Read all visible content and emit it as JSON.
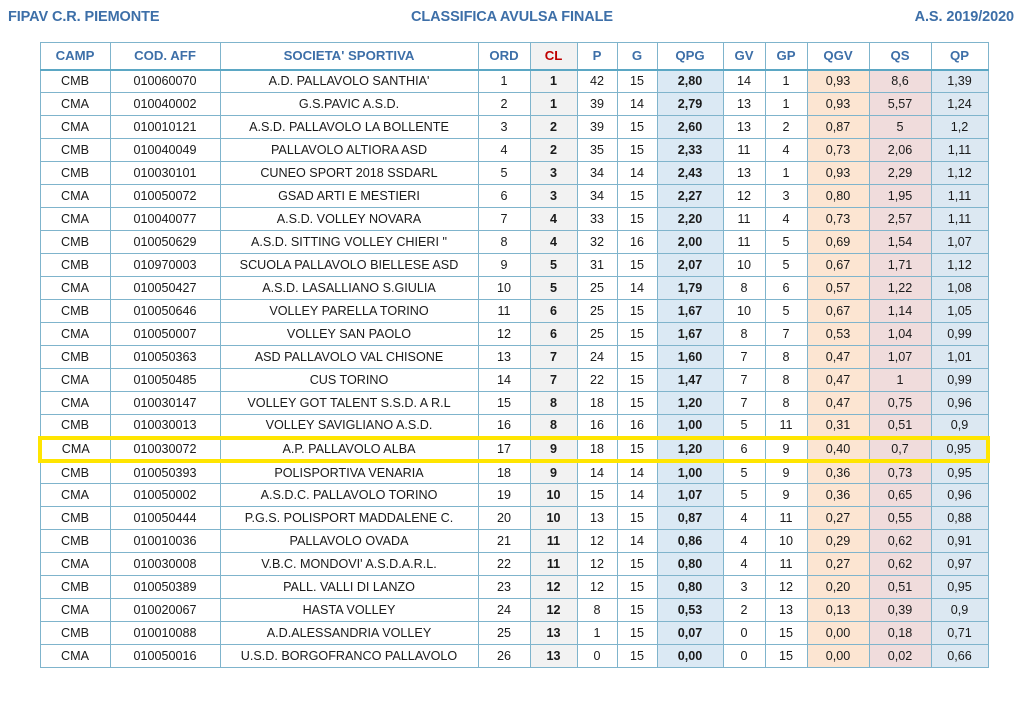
{
  "header": {
    "left": "FIPAV C.R. PIEMONTE",
    "center": "CLASSIFICA AVULSA FINALE",
    "right": "A.S. 2019/2020"
  },
  "colors": {
    "header_text": "#3d6fa8",
    "border": "#7fb4cc",
    "cl_text": "#c00000",
    "qpg_bg": "#dbe9f4",
    "qgv_bg": "#fce5d2",
    "qs_bg": "#f0dcdc",
    "qp_bg": "#dce8f2",
    "cl_bg": "#f2f2f2",
    "highlight": "#ffe500"
  },
  "table": {
    "columns": [
      {
        "key": "camp",
        "label": "CAMP"
      },
      {
        "key": "cod",
        "label": "COD. AFF"
      },
      {
        "key": "soc",
        "label": "SOCIETA' SPORTIVA"
      },
      {
        "key": "ord",
        "label": "ORD"
      },
      {
        "key": "cl",
        "label": "CL"
      },
      {
        "key": "p",
        "label": "P"
      },
      {
        "key": "g",
        "label": "G"
      },
      {
        "key": "qpg",
        "label": "QPG"
      },
      {
        "key": "gv",
        "label": "GV"
      },
      {
        "key": "gp",
        "label": "GP"
      },
      {
        "key": "qgv",
        "label": "QGV"
      },
      {
        "key": "qs",
        "label": "QS"
      },
      {
        "key": "qp",
        "label": "QP"
      }
    ],
    "highlighted_row_index": 16,
    "rows": [
      [
        "CMB",
        "010060070",
        "A.D. PALLAVOLO SANTHIA'",
        "1",
        "1",
        "42",
        "15",
        "2,80",
        "14",
        "1",
        "0,93",
        "8,6",
        "1,39"
      ],
      [
        "CMA",
        "010040002",
        "G.S.PAVIC A.S.D.",
        "2",
        "1",
        "39",
        "14",
        "2,79",
        "13",
        "1",
        "0,93",
        "5,57",
        "1,24"
      ],
      [
        "CMA",
        "010010121",
        "A.S.D. PALLAVOLO LA BOLLENTE",
        "3",
        "2",
        "39",
        "15",
        "2,60",
        "13",
        "2",
        "0,87",
        "5",
        "1,2"
      ],
      [
        "CMB",
        "010040049",
        "PALLAVOLO ALTIORA ASD",
        "4",
        "2",
        "35",
        "15",
        "2,33",
        "11",
        "4",
        "0,73",
        "2,06",
        "1,11"
      ],
      [
        "CMB",
        "010030101",
        "CUNEO SPORT 2018 SSDARL",
        "5",
        "3",
        "34",
        "14",
        "2,43",
        "13",
        "1",
        "0,93",
        "2,29",
        "1,12"
      ],
      [
        "CMA",
        "010050072",
        "GSAD ARTI E MESTIERI",
        "6",
        "3",
        "34",
        "15",
        "2,27",
        "12",
        "3",
        "0,80",
        "1,95",
        "1,11"
      ],
      [
        "CMA",
        "010040077",
        "A.S.D. VOLLEY NOVARA",
        "7",
        "4",
        "33",
        "15",
        "2,20",
        "11",
        "4",
        "0,73",
        "2,57",
        "1,11"
      ],
      [
        "CMB",
        "010050629",
        "A.S.D. SITTING VOLLEY CHIERI \"",
        "8",
        "4",
        "32",
        "16",
        "2,00",
        "11",
        "5",
        "0,69",
        "1,54",
        "1,07"
      ],
      [
        "CMB",
        "010970003",
        "SCUOLA PALLAVOLO BIELLESE ASD",
        "9",
        "5",
        "31",
        "15",
        "2,07",
        "10",
        "5",
        "0,67",
        "1,71",
        "1,12"
      ],
      [
        "CMA",
        "010050427",
        "A.S.D. LASALLIANO S.GIULIA",
        "10",
        "5",
        "25",
        "14",
        "1,79",
        "8",
        "6",
        "0,57",
        "1,22",
        "1,08"
      ],
      [
        "CMB",
        "010050646",
        "VOLLEY PARELLA TORINO",
        "11",
        "6",
        "25",
        "15",
        "1,67",
        "10",
        "5",
        "0,67",
        "1,14",
        "1,05"
      ],
      [
        "CMA",
        "010050007",
        "VOLLEY SAN PAOLO",
        "12",
        "6",
        "25",
        "15",
        "1,67",
        "8",
        "7",
        "0,53",
        "1,04",
        "0,99"
      ],
      [
        "CMB",
        "010050363",
        "ASD PALLAVOLO VAL CHISONE",
        "13",
        "7",
        "24",
        "15",
        "1,60",
        "7",
        "8",
        "0,47",
        "1,07",
        "1,01"
      ],
      [
        "CMA",
        "010050485",
        "CUS TORINO",
        "14",
        "7",
        "22",
        "15",
        "1,47",
        "7",
        "8",
        "0,47",
        "1",
        "0,99"
      ],
      [
        "CMA",
        "010030147",
        "VOLLEY GOT TALENT S.S.D. A R.L",
        "15",
        "8",
        "18",
        "15",
        "1,20",
        "7",
        "8",
        "0,47",
        "0,75",
        "0,96"
      ],
      [
        "CMB",
        "010030013",
        "VOLLEY SAVIGLIANO A.S.D.",
        "16",
        "8",
        "16",
        "16",
        "1,00",
        "5",
        "11",
        "0,31",
        "0,51",
        "0,9"
      ],
      [
        "CMA",
        "010030072",
        "A.P. PALLAVOLO ALBA",
        "17",
        "9",
        "18",
        "15",
        "1,20",
        "6",
        "9",
        "0,40",
        "0,7",
        "0,95"
      ],
      [
        "CMB",
        "010050393",
        "POLISPORTIVA VENARIA",
        "18",
        "9",
        "14",
        "14",
        "1,00",
        "5",
        "9",
        "0,36",
        "0,73",
        "0,95"
      ],
      [
        "CMA",
        "010050002",
        "A.S.D.C. PALLAVOLO TORINO",
        "19",
        "10",
        "15",
        "14",
        "1,07",
        "5",
        "9",
        "0,36",
        "0,65",
        "0,96"
      ],
      [
        "CMB",
        "010050444",
        "P.G.S. POLISPORT MADDALENE C.",
        "20",
        "10",
        "13",
        "15",
        "0,87",
        "4",
        "11",
        "0,27",
        "0,55",
        "0,88"
      ],
      [
        "CMB",
        "010010036",
        "PALLAVOLO OVADA",
        "21",
        "11",
        "12",
        "14",
        "0,86",
        "4",
        "10",
        "0,29",
        "0,62",
        "0,91"
      ],
      [
        "CMA",
        "010030008",
        "V.B.C. MONDOVI' A.S.D.A.R.L.",
        "22",
        "11",
        "12",
        "15",
        "0,80",
        "4",
        "11",
        "0,27",
        "0,62",
        "0,97"
      ],
      [
        "CMB",
        "010050389",
        "PALL. VALLI DI LANZO",
        "23",
        "12",
        "12",
        "15",
        "0,80",
        "3",
        "12",
        "0,20",
        "0,51",
        "0,95"
      ],
      [
        "CMA",
        "010020067",
        "HASTA VOLLEY",
        "24",
        "12",
        "8",
        "15",
        "0,53",
        "2",
        "13",
        "0,13",
        "0,39",
        "0,9"
      ],
      [
        "CMB",
        "010010088",
        "A.D.ALESSANDRIA VOLLEY",
        "25",
        "13",
        "1",
        "15",
        "0,07",
        "0",
        "15",
        "0,00",
        "0,18",
        "0,71"
      ],
      [
        "CMA",
        "010050016",
        "U.S.D. BORGOFRANCO PALLAVOLO",
        "26",
        "13",
        "0",
        "15",
        "0,00",
        "0",
        "15",
        "0,00",
        "0,02",
        "0,66"
      ]
    ]
  }
}
